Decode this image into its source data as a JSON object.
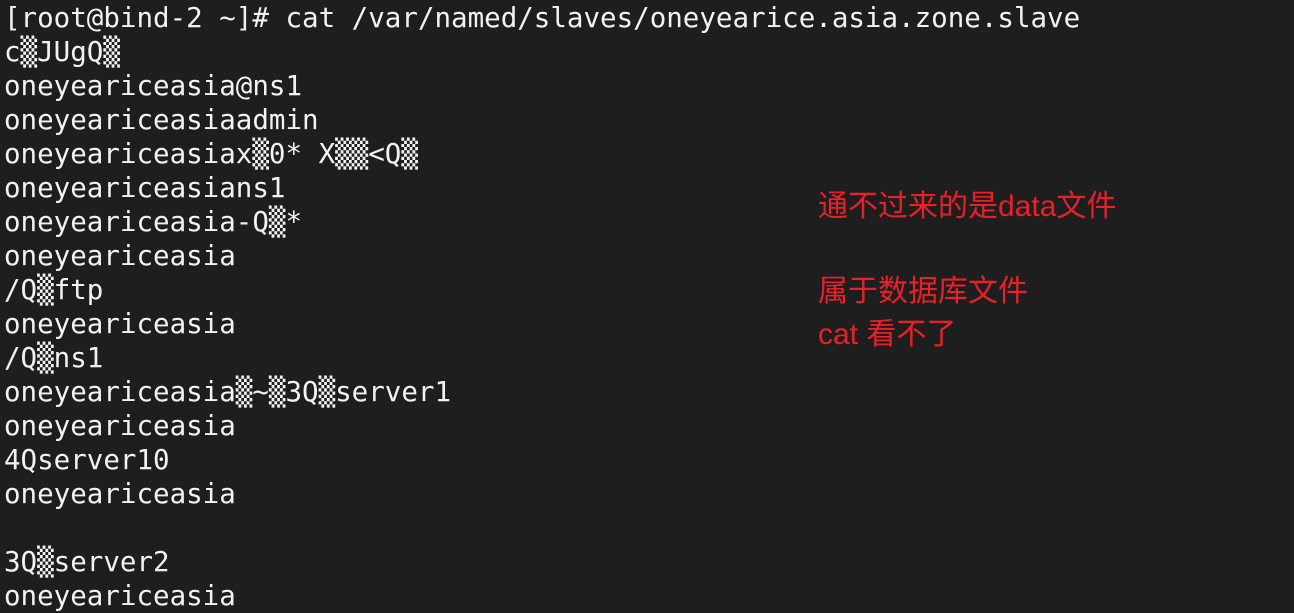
{
  "terminal": {
    "lines": [
      "[root@bind-2 ~]# cat /var/named/slaves/oneyearice.asia.zone.slave",
      "c▒JUgQ▒",
      "oneyeariceasia@ns1",
      "oneyeariceasiaadmin",
      "oneyeariceasiax▒0* X▒▒<Q▒",
      "oneyeariceasians1",
      "oneyeariceasia-Q▒*",
      "oneyeariceasia",
      "/Q▒ftp",
      "oneyeariceasia",
      "/Q▒ns1",
      "oneyeariceasia▒~▒3Q▒server1",
      "oneyeariceasia",
      "4Qserver10",
      "oneyeariceasia",
      "",
      "3Q▒server2",
      "oneyeariceasia"
    ]
  },
  "annotations": {
    "line1": "通不过来的是data文件",
    "line2": "属于数据库文件",
    "line3": "cat 看不了"
  },
  "colors": {
    "background": "#1e1e1e",
    "text": "#f2f2f2",
    "annotation": "#e8202a"
  }
}
